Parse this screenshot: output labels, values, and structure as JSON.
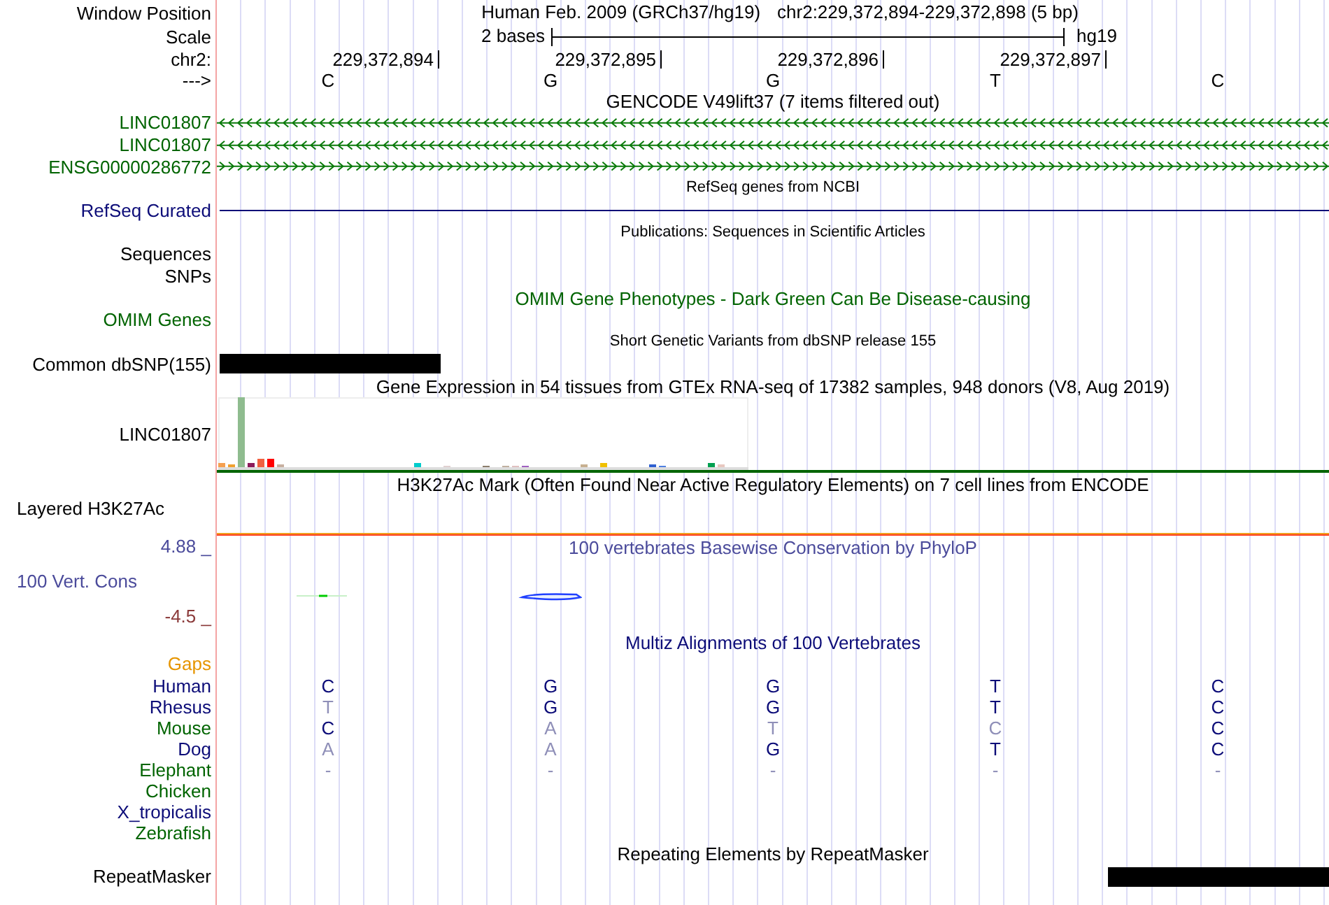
{
  "header": {
    "label": "Window Position",
    "assembly": "Human Feb. 2009 (GRCh37/hg19)",
    "position": "chr2:229,372,894-229,372,898 (5 bp)"
  },
  "scale": {
    "label": "Scale",
    "span": "2 bases",
    "assembly": "hg19"
  },
  "ruler": {
    "label": "chr2:",
    "positions": [
      "229,372,894",
      "229,372,895",
      "229,372,896",
      "229,372,897"
    ]
  },
  "sequence": {
    "label": "--->",
    "bases": [
      "C",
      "G",
      "G",
      "T",
      "C"
    ]
  },
  "tracks": [
    {
      "kind": "title",
      "text": "GENCODE V49lift37 (7 items filtered out)",
      "color": "#000000"
    },
    {
      "kind": "gene",
      "label": "LINC01807",
      "reverse": true,
      "color": "#006400"
    },
    {
      "kind": "gene",
      "label": "LINC01807",
      "reverse": true,
      "color": "#006400"
    },
    {
      "kind": "gene",
      "label": "ENSG00000286772",
      "reverse": false,
      "color": "#006400"
    },
    {
      "kind": "small_title",
      "text": "RefSeq genes from NCBI",
      "color": "#000000"
    },
    {
      "kind": "line",
      "label": "RefSeq Curated",
      "color": "#0c0c78"
    },
    {
      "kind": "small_title",
      "text": "Publications: Sequences in Scientific Articles",
      "color": "#000000"
    },
    {
      "kind": "label",
      "label": "Sequences",
      "color": "#000000"
    },
    {
      "kind": "label",
      "label": "SNPs",
      "color": "#000000"
    },
    {
      "kind": "title",
      "text": "OMIM Gene Phenotypes - Dark Green Can Be Disease-causing",
      "color": "#006400"
    },
    {
      "kind": "label",
      "label": "OMIM Genes",
      "color": "#006400"
    },
    {
      "kind": "small_title",
      "text": "Short Genetic Variants from dbSNP release 155",
      "color": "#000000"
    },
    {
      "kind": "bar",
      "label": "Common dbSNP(155)",
      "right_aligned": false,
      "color": "#000000"
    },
    {
      "kind": "title",
      "text": "Gene Expression in 54 tissues from GTEx RNA-seq of 17382 samples, 948 donors (V8, Aug 2019)",
      "color": "#000000"
    },
    {
      "kind": "expression",
      "label": "LINC01807",
      "color": "#000000"
    },
    {
      "kind": "title",
      "text": "H3K27Ac Mark (Often Found Near Active Regulatory Elements) on 7 cell lines from ENCODE",
      "color": "#000000"
    },
    {
      "kind": "signal",
      "label": "Layered H3K27Ac",
      "color": "#000000"
    },
    {
      "kind": "conservation",
      "label": "100 Vert. Cons",
      "text": "100 vertebrates Basewise Conservation by PhyloP",
      "max": "4.88 _",
      "min": "-4.5 _",
      "color": "#4b4b9b"
    },
    {
      "kind": "title",
      "text": "Multiz Alignments of 100 Vertebrates",
      "color": "#0c0c78"
    },
    {
      "kind": "label",
      "label": "Gaps",
      "color": "#e69500"
    },
    {
      "kind": "alignment",
      "species": [
        {
          "name": "Human",
          "color": "#0c0c78",
          "bases": [
            {
              "base": "C",
              "faded": false
            },
            {
              "base": "G",
              "faded": false
            },
            {
              "base": "G",
              "faded": false
            },
            {
              "base": "T",
              "faded": false
            },
            {
              "base": "C",
              "faded": false
            }
          ]
        },
        {
          "name": "Rhesus",
          "color": "#0c0c78",
          "bases": [
            {
              "base": "T",
              "faded": true
            },
            {
              "base": "G",
              "faded": false
            },
            {
              "base": "G",
              "faded": false
            },
            {
              "base": "T",
              "faded": false
            },
            {
              "base": "C",
              "faded": false
            }
          ]
        },
        {
          "name": "Mouse",
          "color": "#006400",
          "bases": [
            {
              "base": "C",
              "faded": false
            },
            {
              "base": "A",
              "faded": true
            },
            {
              "base": "T",
              "faded": true
            },
            {
              "base": "C",
              "faded": true
            },
            {
              "base": "C",
              "faded": false
            }
          ]
        },
        {
          "name": "Dog",
          "color": "#0c0c78",
          "bases": [
            {
              "base": "A",
              "faded": true
            },
            {
              "base": "A",
              "faded": true
            },
            {
              "base": "G",
              "faded": false
            },
            {
              "base": "T",
              "faded": false
            },
            {
              "base": "C",
              "faded": false
            }
          ]
        },
        {
          "name": "Elephant",
          "color": "#006400",
          "bases": [
            {
              "base": "-",
              "faded": true
            },
            {
              "base": "-",
              "faded": true
            },
            {
              "base": "-",
              "faded": true
            },
            {
              "base": "-",
              "faded": true
            },
            {
              "base": "-",
              "faded": true
            }
          ]
        },
        {
          "name": "Chicken",
          "color": "#006400"
        },
        {
          "name": "X_tropicalis",
          "color": "#0c0c78"
        },
        {
          "name": "Zebrafish",
          "color": "#006400"
        }
      ]
    },
    {
      "kind": "title",
      "text": "Repeating Elements by RepeatMasker",
      "color": "#000000"
    },
    {
      "kind": "bar",
      "label": "RepeatMasker",
      "right_aligned": true,
      "color": "#000000"
    }
  ]
}
